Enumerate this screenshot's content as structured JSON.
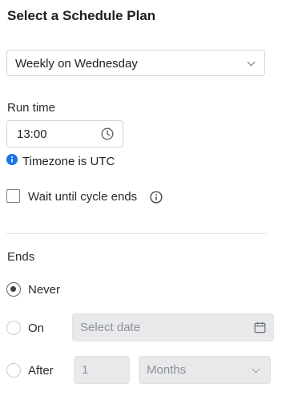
{
  "header": {
    "title": "Select a Schedule Plan"
  },
  "schedule": {
    "selected": "Weekly on Wednesday",
    "icon": "chevron-down-icon"
  },
  "run_time": {
    "label": "Run time",
    "value": "13:00",
    "icon": "clock-icon"
  },
  "timezone": {
    "text": "Timezone is UTC",
    "icon": "info-icon",
    "icon_color": "#1a73e8"
  },
  "wait": {
    "label": "Wait until cycle ends",
    "checked": false,
    "icon": "info-outline-icon"
  },
  "ends": {
    "label": "Ends",
    "selected": "Never",
    "options": {
      "never": {
        "label": "Never"
      },
      "on": {
        "label": "On",
        "date_placeholder": "Select date",
        "icon": "calendar-icon"
      },
      "after": {
        "label": "After",
        "count": "1",
        "unit": "Months",
        "icon": "chevron-down-icon"
      }
    }
  }
}
